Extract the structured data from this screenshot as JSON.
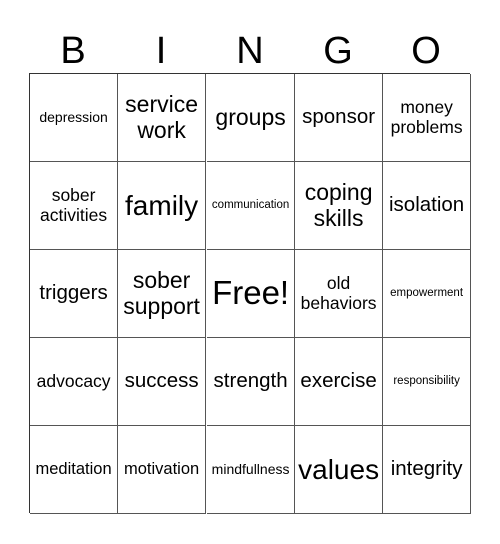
{
  "header": {
    "letters": [
      "B",
      "I",
      "N",
      "G",
      "O"
    ]
  },
  "board": {
    "rows": [
      [
        {
          "text": "depression",
          "size": "small"
        },
        {
          "text": "service work",
          "size": "large"
        },
        {
          "text": "groups",
          "size": "large"
        },
        {
          "text": "sponsor",
          "size": "medium-large"
        },
        {
          "text": "money problems",
          "size": "medium"
        }
      ],
      [
        {
          "text": "sober activities",
          "size": "medium"
        },
        {
          "text": "family",
          "size": "xlarge"
        },
        {
          "text": "communication",
          "size": "tiny"
        },
        {
          "text": "coping skills",
          "size": "large"
        },
        {
          "text": "isolation",
          "size": "medium-large"
        }
      ],
      [
        {
          "text": "triggers",
          "size": "medium-large"
        },
        {
          "text": "sober support",
          "size": "large"
        },
        {
          "text": "Free!",
          "size": "xxlarge"
        },
        {
          "text": "old behaviors",
          "size": "medium"
        },
        {
          "text": "empowerment",
          "size": "tiny"
        }
      ],
      [
        {
          "text": "advocacy",
          "size": "medium"
        },
        {
          "text": "success",
          "size": "medium-large"
        },
        {
          "text": "strength",
          "size": "medium-large"
        },
        {
          "text": "exercise",
          "size": "medium-large"
        },
        {
          "text": "responsibility",
          "size": "tiny"
        }
      ],
      [
        {
          "text": "meditation",
          "size": "medium-small"
        },
        {
          "text": "motivation",
          "size": "medium-small"
        },
        {
          "text": "mindfullness",
          "size": "small"
        },
        {
          "text": "values",
          "size": "xlarge"
        },
        {
          "text": "integrity",
          "size": "medium-large"
        }
      ]
    ]
  }
}
